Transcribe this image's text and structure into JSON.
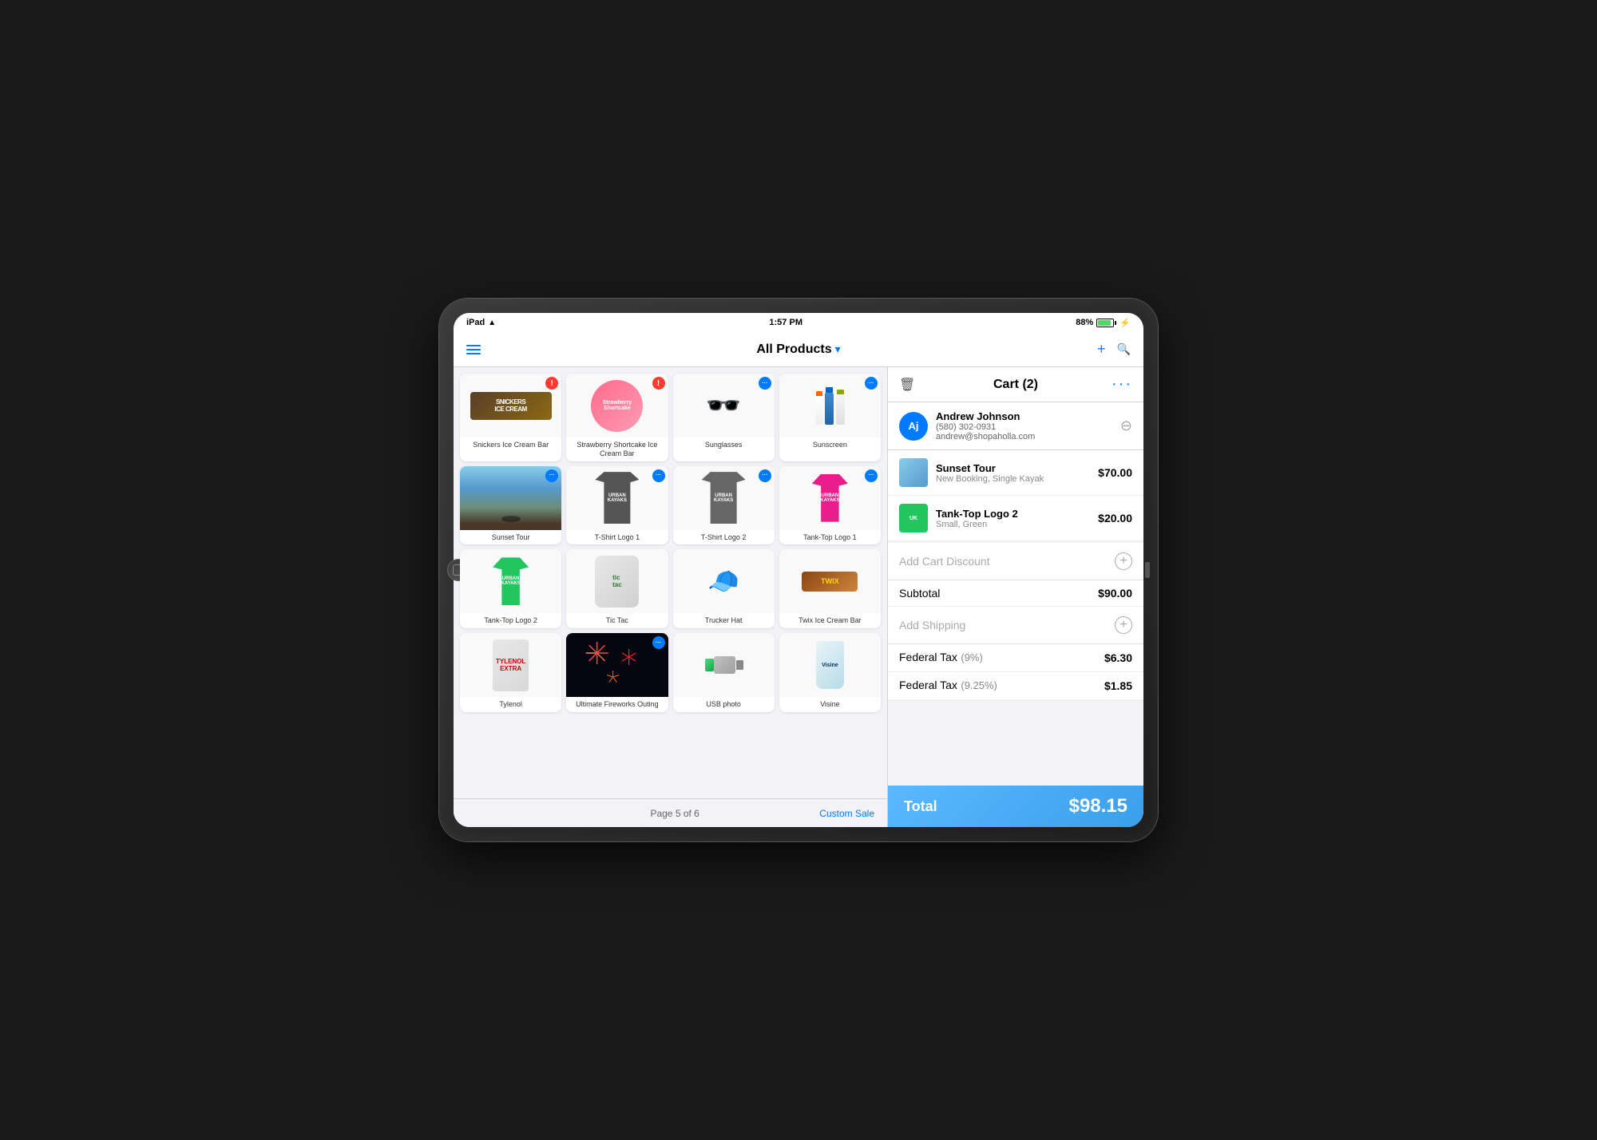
{
  "device": {
    "status_bar": {
      "device_name": "iPad",
      "wifi": "wifi",
      "time": "1:57 PM",
      "battery_percent": "88%",
      "charging": true
    }
  },
  "navbar": {
    "title": "All Products",
    "chevron": "▾",
    "add_label": "+",
    "search_label": "🔍"
  },
  "products": {
    "grid": [
      {
        "id": 1,
        "name": "Snickers Ice Cream Bar",
        "badge": "!",
        "badge_type": "red"
      },
      {
        "id": 2,
        "name": "Strawberry Shortcake Ice Cream Bar",
        "badge": "!",
        "badge_type": "red"
      },
      {
        "id": 3,
        "name": "Sunglasses",
        "badge": "...",
        "badge_type": "blue"
      },
      {
        "id": 4,
        "name": "Sunscreen",
        "badge": "...",
        "badge_type": "blue"
      },
      {
        "id": 5,
        "name": "Sunset Tour",
        "badge": "...",
        "badge_type": "blue"
      },
      {
        "id": 6,
        "name": "T-Shirt Logo 1",
        "badge": "...",
        "badge_type": "blue"
      },
      {
        "id": 7,
        "name": "T-Shirt Logo 2",
        "badge": "...",
        "badge_type": "blue"
      },
      {
        "id": 8,
        "name": "Tank-Top Logo 1",
        "badge": "...",
        "badge_type": "blue"
      },
      {
        "id": 9,
        "name": "Tank-Top Logo 2",
        "badge": null
      },
      {
        "id": 10,
        "name": "Tic Tac",
        "badge": null
      },
      {
        "id": 11,
        "name": "Trucker Hat",
        "badge": null
      },
      {
        "id": 12,
        "name": "Twix Ice Cream Bar",
        "badge": null
      },
      {
        "id": 13,
        "name": "Tylenol",
        "badge": null
      },
      {
        "id": 14,
        "name": "Ultimate Fireworks Outing",
        "badge": "...",
        "badge_type": "blue"
      },
      {
        "id": 15,
        "name": "USB photo",
        "badge": null
      },
      {
        "id": 16,
        "name": "Visine",
        "badge": null
      }
    ],
    "pagination": "Page 5 of 6",
    "custom_sale": "Custom Sale"
  },
  "cart": {
    "header_title": "Cart (2)",
    "customer": {
      "initials": "Aj",
      "name": "Andrew Johnson",
      "phone": "(580) 302-0931",
      "email": "andrew@shopaholla.com"
    },
    "items": [
      {
        "name": "Sunset Tour",
        "sub": "New Booking, Single Kayak",
        "price": "$70.00"
      },
      {
        "name": "Tank-Top Logo 2",
        "sub": "Small, Green",
        "price": "$20.00"
      }
    ],
    "add_cart_discount": "Add Cart Discount",
    "subtotal_label": "Subtotal",
    "subtotal_value": "$90.00",
    "add_shipping": "Add Shipping",
    "taxes": [
      {
        "label": "Federal Tax",
        "rate": "(9%)",
        "value": "$6.30"
      },
      {
        "label": "Federal Tax",
        "rate": "(9.25%)",
        "value": "$1.85"
      }
    ],
    "total_label": "Total",
    "total_value": "$98.15"
  },
  "colors": {
    "accent": "#007aff",
    "total_bg": "#4dabf7",
    "badge_red": "#ff3b30",
    "badge_blue": "#007aff"
  }
}
